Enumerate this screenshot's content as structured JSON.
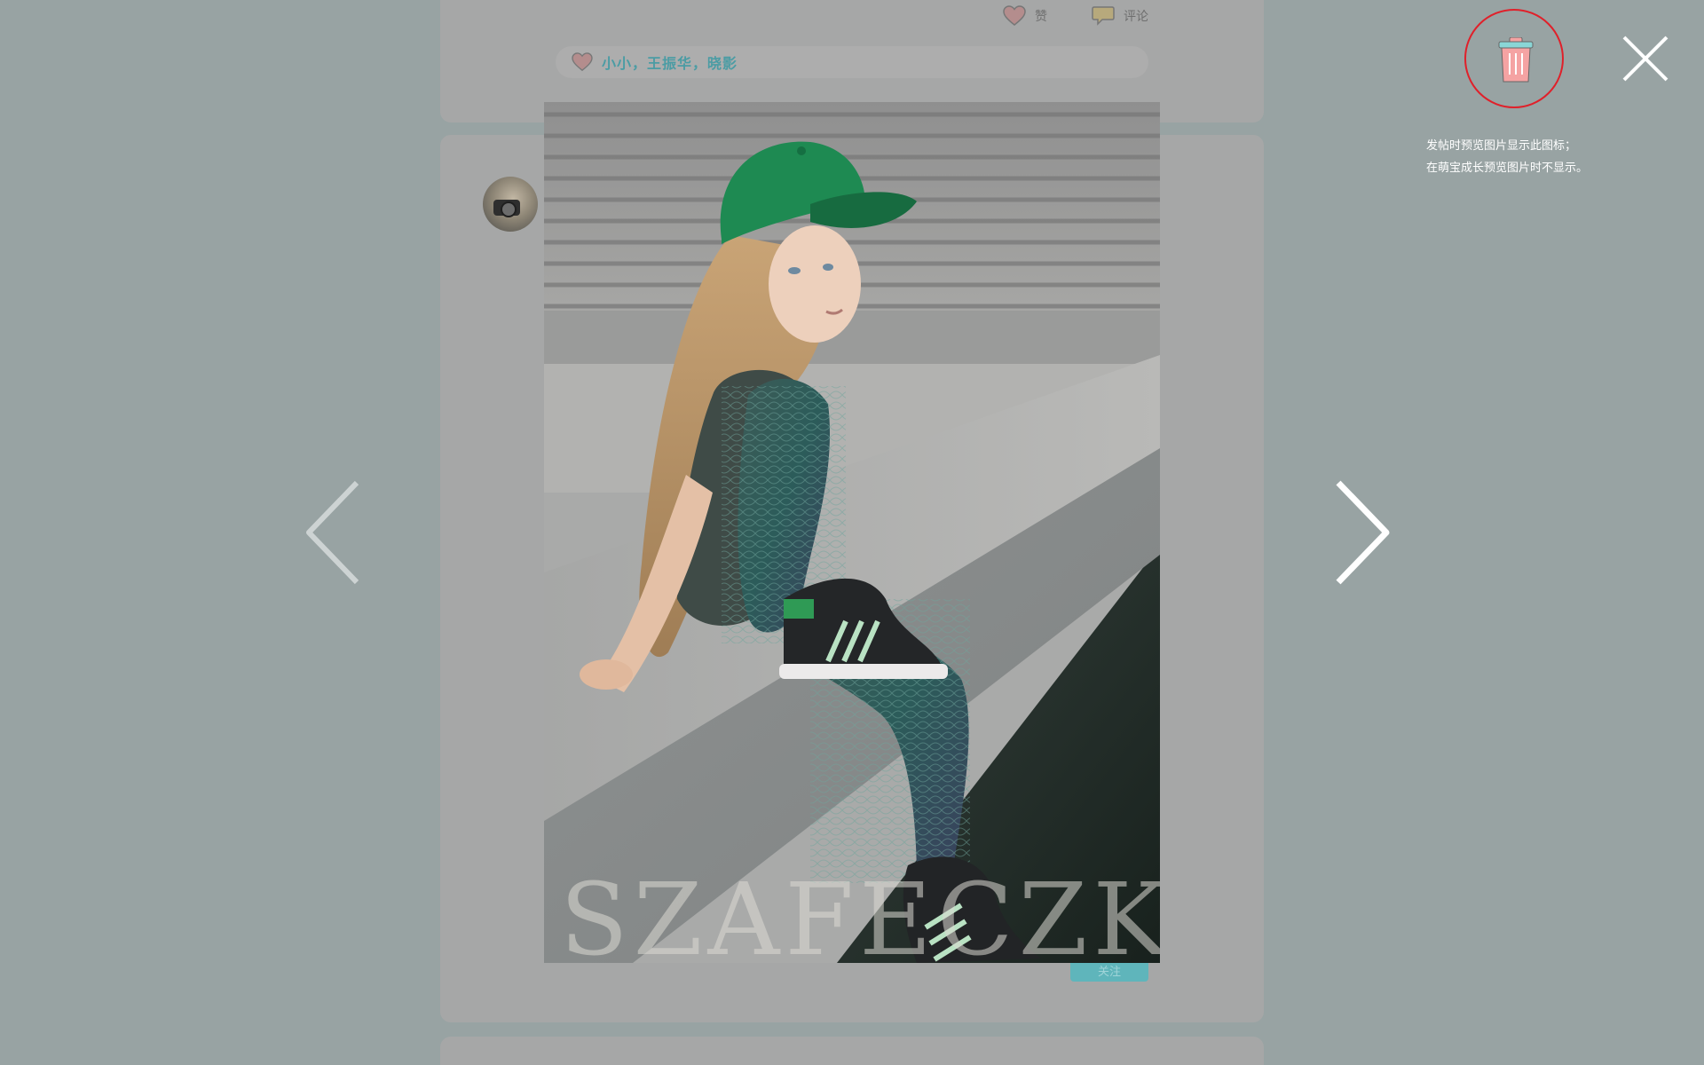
{
  "feed": {
    "like_label": "赞",
    "comment_label": "评论",
    "likers": "小小，王振华，晓影",
    "follow_label": "关注"
  },
  "viewer": {
    "photo_watermark": "SZAFECZKA",
    "prev_icon": "chevron-left-icon",
    "next_icon": "chevron-right-icon",
    "delete_icon": "trash-icon",
    "close_icon": "close-icon",
    "note_lines": [
      "发帖时预览图片显示此图标；",
      "在萌宝成长预览图片时不显示。"
    ]
  },
  "colors": {
    "overlay_bg": "#98a3a3",
    "highlight_ring": "#e0202a",
    "trash_body": "#f5a3a3",
    "trash_lid": "#8ad6d6",
    "likers_text": "#4b9ca4"
  }
}
